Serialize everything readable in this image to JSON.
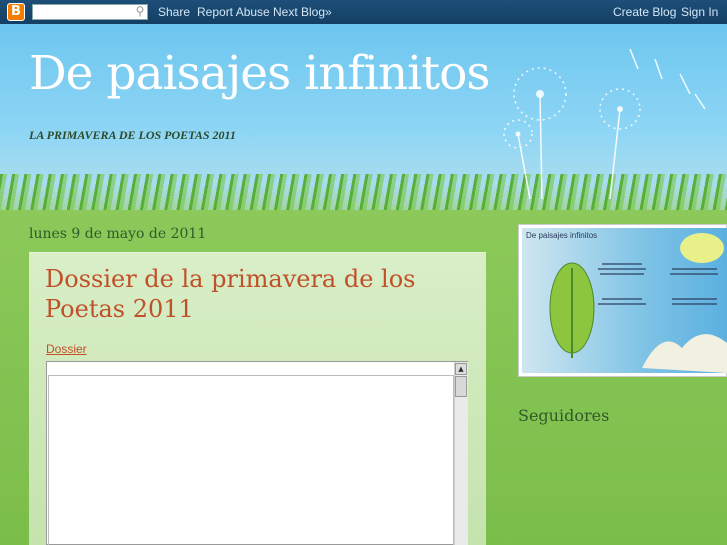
{
  "navbar": {
    "logo_letter": "B",
    "search_placeholder": "",
    "share": "Share",
    "report_abuse": "Report Abuse",
    "next_blog": "Next Blog»",
    "create_blog": "Create Blog",
    "sign_in": "Sign In",
    "logo_color": "#f57d00"
  },
  "header": {
    "title": "De paisajes infinitos",
    "description": "LA PRIMAVERA DE LOS POETAS 2011"
  },
  "post": {
    "date": "lunes 9 de mayo de 2011",
    "title": "Dossier de la primavera de los Poetas 2011",
    "link_label": "Dossier",
    "title_color": "#c0502a"
  },
  "sidebar": {
    "image_caption": "De paisajes infinitos",
    "followers_heading": "Seguidores"
  },
  "icons": {
    "search": "search-icon",
    "scroll_up": "scroll-up-arrow-icon"
  }
}
